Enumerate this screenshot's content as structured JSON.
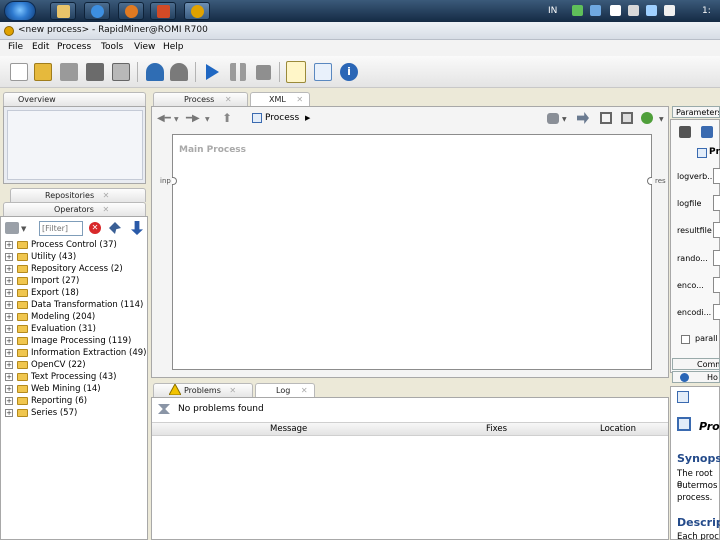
{
  "taskbar": {
    "tray_text": "IN",
    "clock_text": "1:",
    "colors": {
      "start": "#2e7ad0",
      "bar": "#1f3a58"
    }
  },
  "window": {
    "title": "<new process> - RapidMiner@ROMI R700",
    "icon": "rapidminer-icon"
  },
  "menu": {
    "items": [
      "File",
      "Edit",
      "Process",
      "Tools",
      "View",
      "Help"
    ]
  },
  "toolbar": {
    "icons": [
      "new-icon",
      "open-icon",
      "save-icon",
      "save-as-icon",
      "export-icon",
      "undo-icon",
      "redo-icon",
      "run-icon",
      "pause-icon",
      "stop-icon",
      "result-icon",
      "perspective-icon",
      "info-icon"
    ]
  },
  "overview": {
    "tab_label": "Overview"
  },
  "repositories": {
    "tab_label": "Repositories"
  },
  "operators": {
    "tab_label": "Operators",
    "filter_placeholder": "[Filter]",
    "tree": [
      {
        "label": "Process Control (37)"
      },
      {
        "label": "Utility (43)"
      },
      {
        "label": "Repository Access (2)"
      },
      {
        "label": "Import (27)"
      },
      {
        "label": "Export (18)"
      },
      {
        "label": "Data Transformation (114)"
      },
      {
        "label": "Modeling (204)"
      },
      {
        "label": "Evaluation (31)"
      },
      {
        "label": "Image Processing (119)"
      },
      {
        "label": "Information Extraction (49)"
      },
      {
        "label": "OpenCV (22)"
      },
      {
        "label": "Text Processing (43)"
      },
      {
        "label": "Web Mining (14)"
      },
      {
        "label": "Reporting (6)"
      },
      {
        "label": "Series (57)"
      }
    ]
  },
  "process": {
    "tab_process": "Process",
    "tab_xml": "XML",
    "breadcrumb": "Process",
    "canvas_title": "Main Process",
    "port_in": "inp",
    "port_out": "res"
  },
  "problems": {
    "tab_problems": "Problems",
    "tab_log": "Log",
    "status": "No problems found",
    "columns": [
      "Message",
      "Fixes",
      "Location"
    ]
  },
  "parameters": {
    "tab_label": "Parameters",
    "header": "Pro",
    "fields": [
      "logverb...",
      "logfile",
      "resultfile",
      "rando...",
      "enco...",
      "encodi..."
    ],
    "checkbox_label": "parall",
    "comment_tab": "Comm",
    "help_tab": "Ho"
  },
  "help": {
    "title": "Pro",
    "synopsis_heading": "Synopsi",
    "synopsis_lines": [
      "The root o",
      "outermos",
      "process."
    ],
    "description_heading": "Descrip",
    "description_line": "Each proc"
  }
}
